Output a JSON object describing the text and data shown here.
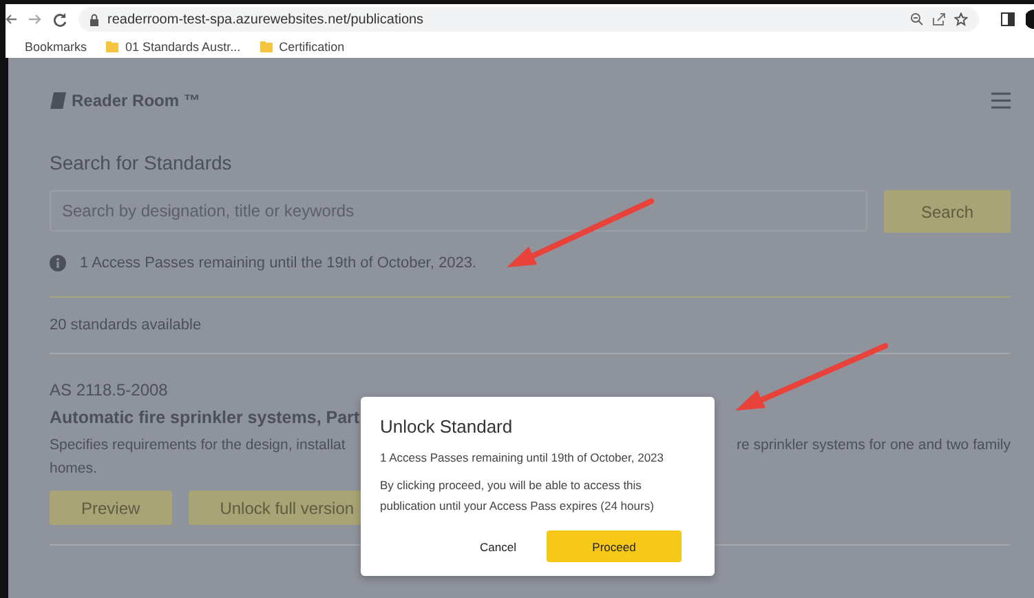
{
  "browser": {
    "url": "readerroom-test-spa.azurewebsites.net/publications",
    "bookmarks": [
      {
        "label": "Bookmarks",
        "kind": "text"
      },
      {
        "label": "01 Standards Austr...",
        "kind": "folder"
      },
      {
        "label": "Certification",
        "kind": "folder"
      }
    ]
  },
  "header": {
    "logo": "Reader Room ™"
  },
  "search": {
    "heading": "Search for Standards",
    "placeholder": "Search by designation, title or keywords",
    "button": "Search"
  },
  "info": "1 Access Passes remaining until the 19th of October, 2023.",
  "count": "20 standards available",
  "standard": {
    "designation": "AS 2118.5-2008",
    "title": "Automatic fire sprinkler systems, Part",
    "description_left": "Specifies requirements for the design, installat",
    "description_right": "re sprinkler systems for one and two family",
    "description_end": "homes.",
    "buttons": [
      "Preview",
      "Unlock full version"
    ]
  },
  "dialog": {
    "title": "Unlock Standard",
    "passes": "1 Access Passes remaining until 19th of October, 2023",
    "message": "By clicking proceed, you will be able to access this publication until your Access Pass expires (24 hours)",
    "buttons": [
      {
        "label": "Cancel",
        "kind": "text"
      },
      {
        "label": "Proceed",
        "kind": "primary"
      }
    ]
  }
}
